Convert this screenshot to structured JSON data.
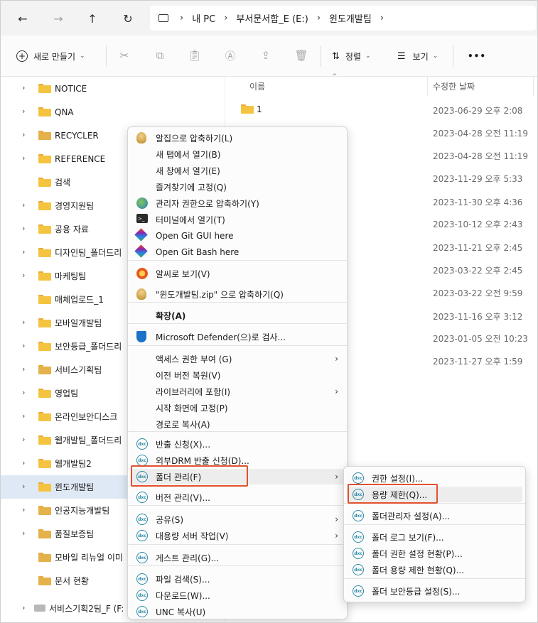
{
  "address": {
    "segments": [
      "내 PC",
      "부서문서함_E (E:)",
      "윈도개발팀"
    ]
  },
  "toolbar": {
    "new_label": "새로 만들기",
    "sort_label": "정렬",
    "view_label": "보기",
    "more_label": "•••"
  },
  "nav": {
    "items": [
      {
        "label": "NOTICE"
      },
      {
        "label": "QNA"
      },
      {
        "label": "RECYCLER"
      },
      {
        "label": "REFERENCE"
      },
      {
        "label": "검색"
      },
      {
        "label": "경영지원팀"
      },
      {
        "label": "공용 자료"
      },
      {
        "label": "디자인팀_폴더드리"
      },
      {
        "label": "마케팅팀"
      },
      {
        "label": "매체업로드_1"
      },
      {
        "label": "모바일개발팀"
      },
      {
        "label": "보안등급_폴더드리"
      },
      {
        "label": "서비스기획팀"
      },
      {
        "label": "영업팀"
      },
      {
        "label": "온라인보안디스크"
      },
      {
        "label": "웹개발팀_폴더드리"
      },
      {
        "label": "웹개발팀2"
      },
      {
        "label": "윈도개발팀"
      },
      {
        "label": "인공지능개발팀"
      },
      {
        "label": "품질보증팀"
      },
      {
        "label": "모바일 리뉴얼 이미"
      },
      {
        "label": "문서 현황"
      },
      {
        "label": "서비스기획2팀_F (F:"
      }
    ]
  },
  "list": {
    "col_name": "이름",
    "col_date": "수정한 날짜",
    "first_file": "1",
    "dates": [
      "2023-06-29 오후 2:08",
      "2023-04-28 오전 11:19",
      "2023-04-28 오전 11:19",
      "2023-11-29 오후 5:33",
      "2023-11-30 오후 4:36",
      "2023-10-12 오후 2:43",
      "2023-11-21 오후 2:45",
      "2023-03-22 오후 2:45",
      "2023-03-22 오전 9:59",
      "2023-11-16 오후 3:12",
      "2023-01-05 오전 10:23",
      "2023-11-27 오후 1:59"
    ]
  },
  "menu": {
    "items": [
      {
        "label": "알집으로 압축하기(L)"
      },
      {
        "label": "새 탭에서 열기(B)"
      },
      {
        "label": "새 창에서 열기(E)"
      },
      {
        "label": "즐겨찾기에 고정(Q)"
      },
      {
        "label": "관리자 권한으로 압축하기(Y)"
      },
      {
        "label": "터미널에서 열기(T)"
      },
      {
        "label": "Open Git GUI here"
      },
      {
        "label": "Open Git Bash here"
      },
      {
        "label": "알씨로 보기(V)"
      },
      {
        "label": "\"윈도개발팀.zip\" 으로 압축하기(Q)"
      },
      {
        "label": "확장(A)"
      },
      {
        "label": "Microsoft Defender(으)로 검사..."
      },
      {
        "label": "액세스 권한 부여 (G)"
      },
      {
        "label": "이전 버전 복원(V)"
      },
      {
        "label": "라이브러리에 포함(I)"
      },
      {
        "label": "시작 화면에 고정(P)"
      },
      {
        "label": "경로로 복사(A)"
      },
      {
        "label": "반출 신청(X)..."
      },
      {
        "label": "외부DRM 반출 신청(D)..."
      },
      {
        "label": "폴더 관리(F)"
      },
      {
        "label": "버전 관리(V)..."
      },
      {
        "label": "공유(S)"
      },
      {
        "label": "대용량 서버 작업(V)"
      },
      {
        "label": "게스트 관리(G)..."
      },
      {
        "label": "파일 검색(S)..."
      },
      {
        "label": "다운로드(W)..."
      },
      {
        "label": "UNC 복사(U)"
      }
    ]
  },
  "submenu": {
    "items": [
      {
        "label": "권한 설정(I)..."
      },
      {
        "label": "용량 제한(Q)..."
      },
      {
        "label": "폴더관리자 설정(A)..."
      },
      {
        "label": "폴더 로그 보기(F)..."
      },
      {
        "label": "폴더 권한 설정 현황(P)..."
      },
      {
        "label": "폴더 용량 제한 현황(Q)..."
      },
      {
        "label": "폴더 보안등급 설정(S)..."
      }
    ]
  },
  "colors": {
    "selection": "#dfe9f5",
    "highlight_box": "#e2512f",
    "folder": "#f4c440"
  }
}
